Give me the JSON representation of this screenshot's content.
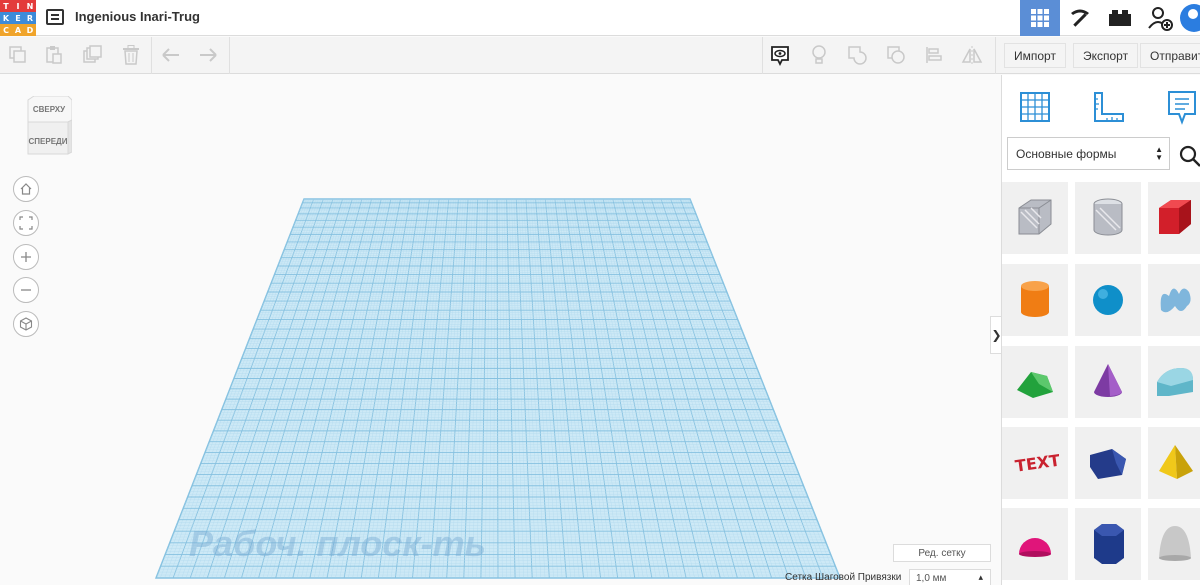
{
  "header": {
    "logo_letters": [
      "T",
      "I",
      "N",
      "K",
      "E",
      "R",
      "C",
      "A",
      "D"
    ],
    "logo_colors": [
      "#e33b3b",
      "#e33b3b",
      "#e33b3b",
      "#3d8bd9",
      "#3d8bd9",
      "#3d8bd9",
      "#f0a42b",
      "#f0a42b",
      "#f0a42b"
    ],
    "design_title": "Ingenious Inari-Trug",
    "modes": [
      "3d-design-grid-icon",
      "codeblocks-pickaxe-icon",
      "bricks-icon",
      "user-add-icon"
    ],
    "active_color": "#5b8ed6"
  },
  "toolbar": {
    "import_label": "Импорт",
    "export_label": "Экспорт",
    "send_label": "Отправить"
  },
  "viewport": {
    "viewcube_top": "СВЕРХУ",
    "viewcube_front": "СПЕРЕДИ",
    "workplane_label": "Рабоч. плоск-ть",
    "edit_grid_label": "Ред. сетку",
    "snap_label": "Сетка Шаговой Привязки",
    "snap_value": "1,0 мм",
    "workplane_color": "#9fd3ec"
  },
  "panel": {
    "shape_category": "Основные формы",
    "shapes": [
      {
        "name": "box-hole",
        "color": "#b9bcc4"
      },
      {
        "name": "cylinder-hole",
        "color": "#b9bcc4"
      },
      {
        "name": "box",
        "color": "#d21f2a"
      },
      {
        "name": "cylinder",
        "color": "#f07d14"
      },
      {
        "name": "sphere",
        "color": "#0f8fc9"
      },
      {
        "name": "scribble",
        "color": "#7fb6dc"
      },
      {
        "name": "roof",
        "color": "#22a23c"
      },
      {
        "name": "cone",
        "color": "#7d3ba3"
      },
      {
        "name": "round-roof",
        "color": "#5fb6c9"
      },
      {
        "name": "text",
        "color": "#c9222f"
      },
      {
        "name": "polygon",
        "color": "#243b8a"
      },
      {
        "name": "pyramid",
        "color": "#f0c81a"
      },
      {
        "name": "half-sphere",
        "color": "#e0157a"
      },
      {
        "name": "hexagonal-prism",
        "color": "#1e3a8a"
      },
      {
        "name": "paraboloid",
        "color": "#c8c8c8"
      }
    ]
  }
}
